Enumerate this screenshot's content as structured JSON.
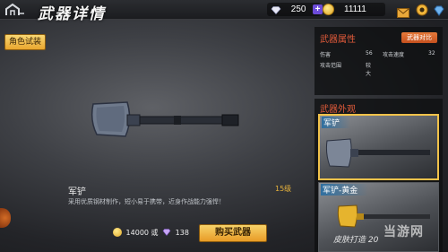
{
  "header": {
    "title": "武器详情"
  },
  "resources": {
    "gems": "250",
    "coins": "11111"
  },
  "left": {
    "role_button": "角色试装"
  },
  "weapon": {
    "name": "军铲",
    "level": "15级",
    "description": "采用优质钢材制作，短小易于携带，近身作战能力强悍！"
  },
  "purchase": {
    "coin_price": "14000",
    "or_label": "或",
    "gem_price": "138",
    "buy_label": "购买武器"
  },
  "attributes": {
    "title": "武器属性",
    "compare_label": "武器对比",
    "stats": [
      {
        "label": "伤害",
        "value": "56"
      },
      {
        "label": "攻击速度",
        "value": "32"
      },
      {
        "label": "攻击范围",
        "value": "较大"
      }
    ]
  },
  "appearance": {
    "title": "武器外观",
    "skins": [
      {
        "label": "军铲"
      },
      {
        "label": "军铲-黄金"
      }
    ]
  },
  "watermark": {
    "line1": "皮肤打造 20",
    "logo": "当游网"
  },
  "colors": {
    "accent_orange": "#e05a3a",
    "gold_button": "#f0b848",
    "selected_border": "#f1c24a"
  }
}
